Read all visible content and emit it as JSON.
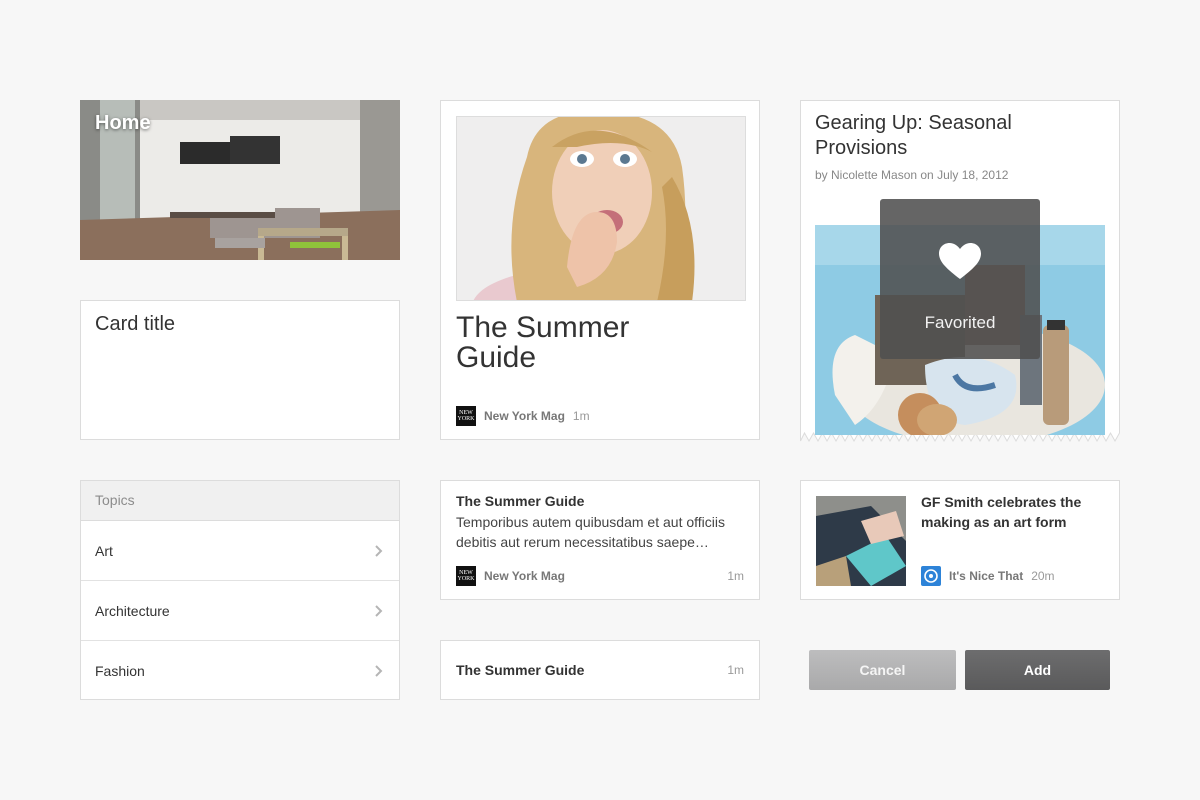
{
  "home_card": {
    "label": "Home"
  },
  "title_card": {
    "title": "Card title"
  },
  "topics": {
    "header": "Topics",
    "items": [
      {
        "label": "Art"
      },
      {
        "label": "Architecture"
      },
      {
        "label": "Fashion"
      }
    ]
  },
  "summer_card": {
    "title": "The Summer Guide",
    "source": "New York Mag",
    "time": "1m",
    "logo_text": "NEW YORK"
  },
  "gear_card": {
    "title": "Gearing Up: Seasonal Provisions",
    "byline": "by Nicolette Mason on July 18, 2012",
    "overlay_label": "Favorited"
  },
  "text_card": {
    "title": "The Summer Guide",
    "body": "Temporibus autem quibusdam et aut officiis debitis aut rerum necessitatibus saepe…",
    "source": "New York Mag",
    "time": "1m"
  },
  "small_card": {
    "title": "The Summer Guide",
    "time": "1m"
  },
  "gf_card": {
    "title": "GF Smith celebrates the making as an art form",
    "source": "It's Nice That",
    "time": "20m"
  },
  "buttons": {
    "cancel": "Cancel",
    "add": "Add"
  },
  "colors": {
    "background": "#f7f7f7",
    "card_border": "#dcdcdc",
    "cancel_button": "#b3b3b4",
    "add_button": "#636364",
    "source_logo_blue": "#2d83d8"
  }
}
